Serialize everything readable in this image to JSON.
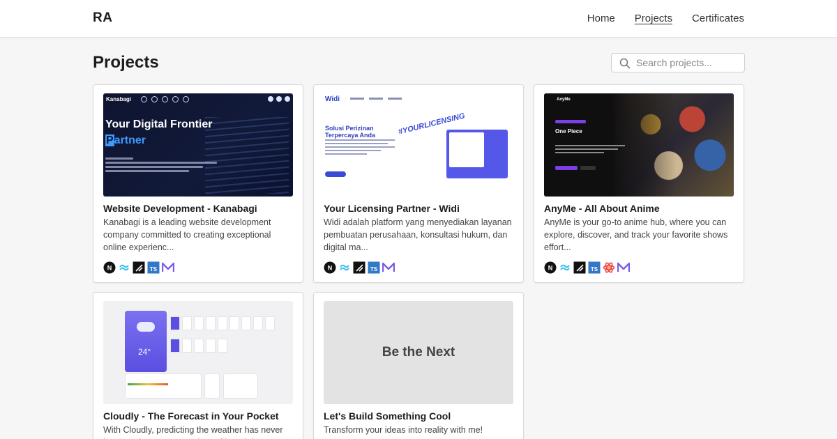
{
  "brand": "RA",
  "nav": {
    "items": [
      "Home",
      "Projects",
      "Certificates"
    ],
    "active": "Projects"
  },
  "page": {
    "title": "Projects"
  },
  "search": {
    "placeholder": "Search projects..."
  },
  "projects": [
    {
      "title": "Website Development - Kanabagi",
      "desc": "Kanabagi is a leading website development company committed to creating exceptional online experienc...",
      "thumb": {
        "heading_line1": "Your Digital Frontier",
        "heading_line2_first": "P",
        "heading_line2_rest": "artner",
        "brand": "Kanabagi"
      },
      "stack": [
        "nextjs-icon",
        "tailwind-icon",
        "shadcn-icon",
        "typescript-icon",
        "mui-icon"
      ]
    },
    {
      "title": "Your Licensing Partner - Widi",
      "desc": "Widi adalah platform yang menyediakan layanan pembuatan perusahaan, konsultasi hukum, dan digital ma...",
      "thumb": {
        "logo": "Widi",
        "headline": "Solusi Perizinan Terpercaya Anda",
        "tag": "#YOURLICENSING"
      },
      "stack": [
        "nextjs-icon",
        "tailwind-icon",
        "shadcn-icon",
        "typescript-icon",
        "mui-icon"
      ]
    },
    {
      "title": "AnyMe - All About Anime",
      "desc": "AnyMe is your go-to anime hub, where you can explore, discover, and track your favorite shows effort...",
      "thumb": {
        "brand": "AnyMe",
        "feature": "One Piece"
      },
      "stack": [
        "nextjs-icon",
        "tailwind-icon",
        "shadcn-icon",
        "typescript-icon",
        "react-query-icon",
        "mui-icon"
      ]
    },
    {
      "title": "Cloudly - The Forecast in Your Pocket",
      "desc": "With Cloudly, predicting the weather has never been easier. Stay up to date with real-time",
      "thumb": {
        "temp": "24°"
      },
      "stack": []
    },
    {
      "title": "Let's Build Something Cool",
      "desc": "Transform your ideas into reality with me!",
      "thumb": {
        "label": "Be the Next"
      },
      "stack": []
    }
  ],
  "colors": {
    "nextjs": "#111111",
    "tailwind": "#38bdf8",
    "typescript": "#3178c6",
    "mui": "#7b5ce6",
    "react_query": "#ef4444",
    "accent": "#3b49d6"
  }
}
